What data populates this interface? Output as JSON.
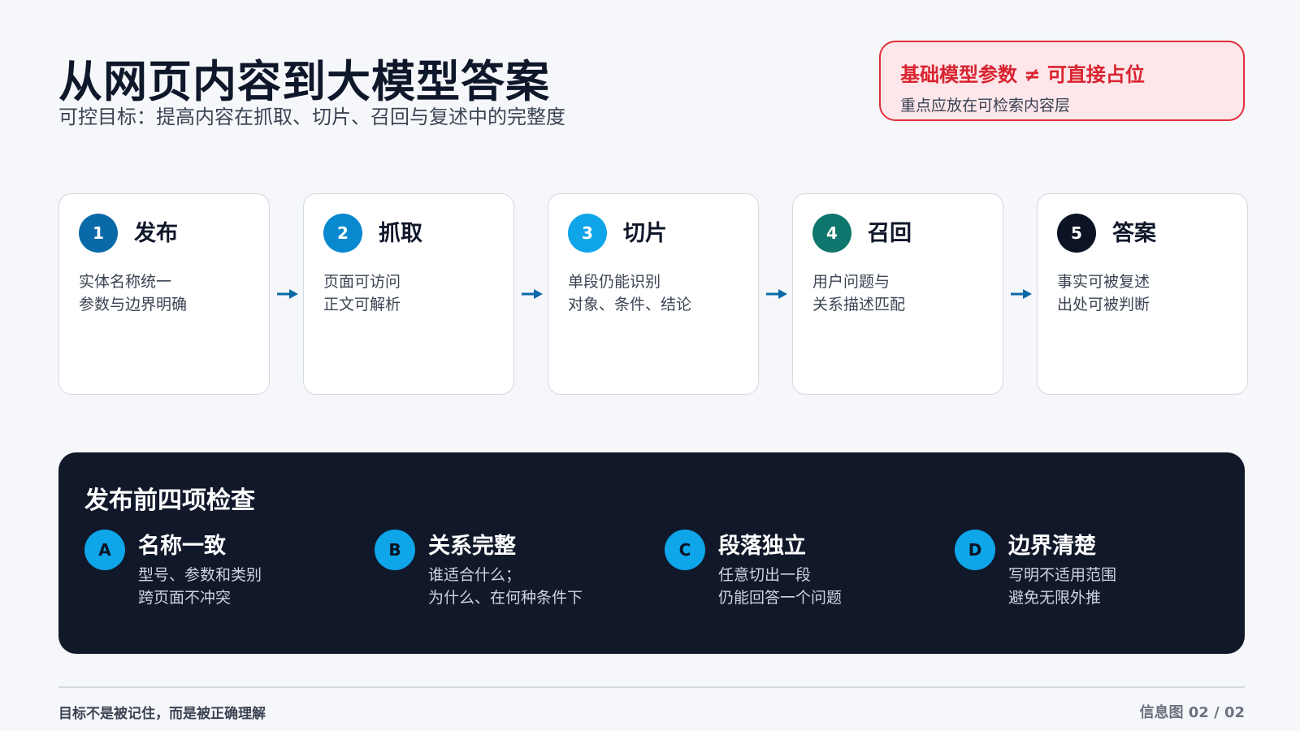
{
  "header": {
    "title": "从网页内容到大模型答案",
    "subtitle": "可控目标：提高内容在抓取、切片、召回与复述中的完整度"
  },
  "callout": {
    "title": "基础模型参数 ≠ 可直接占位",
    "subtitle": "重点应放在可检索内容层"
  },
  "steps": [
    {
      "number": "1",
      "title": "发布",
      "lines": [
        "实体名称统一",
        "参数与边界明确"
      ],
      "color": "#0a6aa8"
    },
    {
      "number": "2",
      "title": "抓取",
      "lines": [
        "页面可访问",
        "正文可解析"
      ],
      "color": "#0788cf"
    },
    {
      "number": "3",
      "title": "切片",
      "lines": [
        "单段仍能识别",
        "对象、条件、结论"
      ],
      "color": "#0ea5e9"
    },
    {
      "number": "4",
      "title": "召回",
      "lines": [
        "用户问题与",
        "关系描述匹配"
      ],
      "color": "#0f766e"
    },
    {
      "number": "5",
      "title": "答案",
      "lines": [
        "事实可被复述",
        "出处可被判断"
      ],
      "color": "#0b1324"
    }
  ],
  "arrow_icon": "arrow-right-icon",
  "arrow_color": "#0a6aa8",
  "checks": {
    "title": "发布前四项检查",
    "items": [
      {
        "letter": "A",
        "title": "名称一致",
        "lines": [
          "型号、参数和类别",
          "跨页面不冲突"
        ]
      },
      {
        "letter": "B",
        "title": "关系完整",
        "lines": [
          "谁适合什么；",
          "为什么、在何种条件下"
        ]
      },
      {
        "letter": "C",
        "title": "段落独立",
        "lines": [
          "任意切出一段",
          "仍能回答一个问题"
        ]
      },
      {
        "letter": "D",
        "title": "边界清楚",
        "lines": [
          "写明不适用范围",
          "避免无限外推"
        ]
      }
    ]
  },
  "footer": {
    "left": "目标不是被记住，而是被正确理解",
    "right": "信息图 02 / 02"
  }
}
